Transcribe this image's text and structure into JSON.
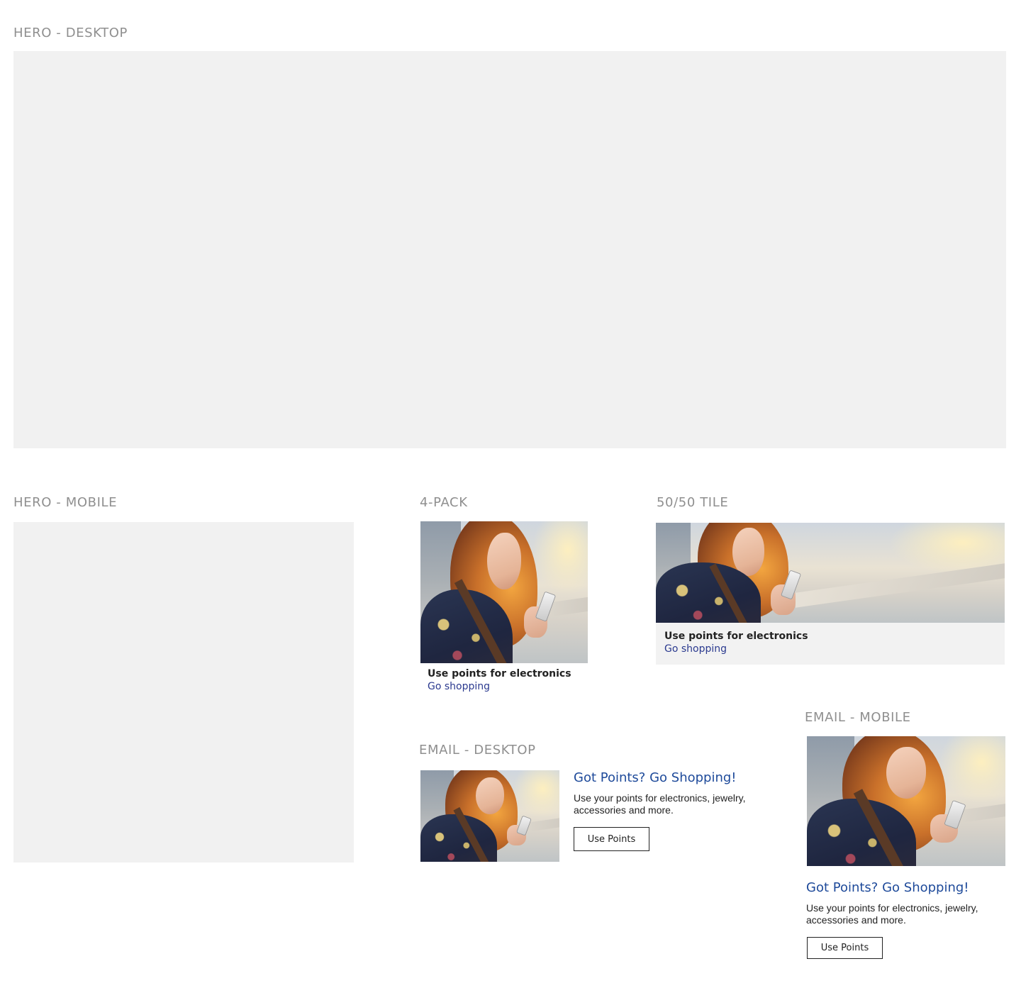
{
  "sections": {
    "hero_desktop": {
      "label": "HERO - DESKTOP"
    },
    "hero_mobile": {
      "label": "HERO - MOBILE"
    },
    "four_pack": {
      "label": "4-PACK",
      "title": "Use points for electronics",
      "link": "Go shopping"
    },
    "fifty_tile": {
      "label": "50/50 TILE",
      "title": "Use points for electronics",
      "link": "Go shopping"
    },
    "email_desktop": {
      "label": "EMAIL - DESKTOP",
      "headline": "Got Points? Go Shopping!",
      "body_line1": "Use your points for electronics, jewelry,",
      "body_line2": "accessories and more.",
      "button": "Use Points"
    },
    "email_mobile": {
      "label": "EMAIL - MOBILE",
      "headline": "Got Points? Go Shopping!",
      "body_line1": "Use your points for electronics, jewelry,",
      "body_line2": "accessories and more.",
      "button": "Use Points"
    }
  },
  "colors": {
    "label_gray": "#8f8f8f",
    "placeholder_gray": "#f1f1f1",
    "link_blue": "#2b3a8f",
    "headline_blue": "#1e4a9a"
  }
}
